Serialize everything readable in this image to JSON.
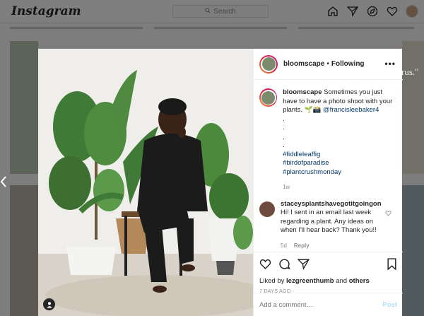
{
  "topbar": {
    "logo": "Instagram",
    "search_placeholder": "Search",
    "icons": [
      "home-icon",
      "send-icon",
      "explore-icon",
      "heart-icon",
      "avatar"
    ]
  },
  "background": {
    "edge_text": "rus.\""
  },
  "post": {
    "header": {
      "username": "bloomscape",
      "separator": "•",
      "follow_status": "Following",
      "more": "•••"
    },
    "caption": {
      "username": "bloomscape",
      "text": "Sometimes you just have to have a photo shoot with your plants. 🌱📸",
      "mention": "@francisleebaker4",
      "dots": [
        ".",
        ".",
        ".",
        "."
      ],
      "hashtags": [
        "#fiddleleaffig",
        "#birdofparadise",
        "#plantcrushmonday"
      ],
      "age": "1w"
    },
    "comment": {
      "username": "staceysplantshavegotitgoingon",
      "text": "Hi! I sent in an email last week regarding a plant. Any ideas on when I'll hear back? Thank you!!",
      "age": "5d",
      "reply": "Reply"
    },
    "likes": {
      "prefix": "Liked by",
      "user": "lezgreenthumb",
      "joiner": "and",
      "others": "others"
    },
    "date": "7 DAYS AGO",
    "add_comment_placeholder": "Add a comment…",
    "post_label": "Post"
  },
  "colors": {
    "link": "#00376b",
    "post_button_disabled": "#b2dffc",
    "overlay": "rgba(0,0,0,0.5)"
  }
}
